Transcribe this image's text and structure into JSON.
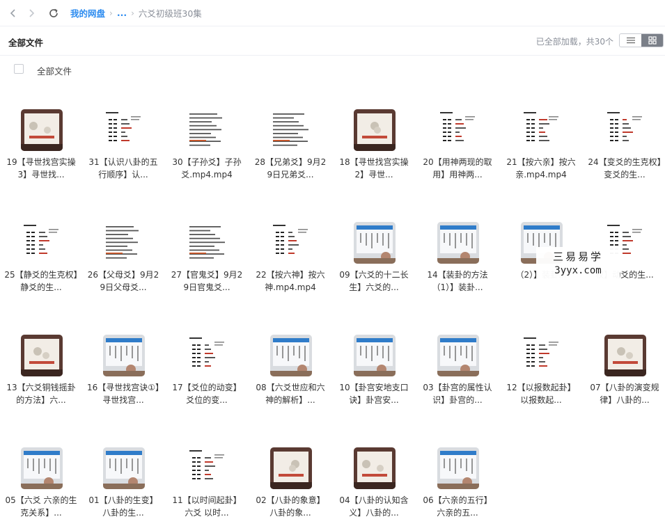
{
  "breadcrumb": {
    "root": "我的网盘",
    "ellipsis": "...",
    "current": "六爻初级班30集"
  },
  "header": {
    "title": "全部文件",
    "status": "已全部加载，共30个",
    "view_modes": [
      "list-view-icon",
      "grid-view-icon"
    ],
    "active_view": "grid"
  },
  "select_all": {
    "label": "全部文件",
    "checked": false
  },
  "files": [
    {
      "name": "19【寻世找宫实操3】寻世找...",
      "thumb": "photo"
    },
    {
      "name": "31【认识八卦的五行顺序】认...",
      "thumb": "chart"
    },
    {
      "name": "30【子孙爻】子孙爻.mp4.mp4",
      "thumb": "text"
    },
    {
      "name": "28【兄弟爻】9月29日兄弟爻...",
      "thumb": "text"
    },
    {
      "name": "18【寻世找宫实操2】寻世...",
      "thumb": "photo"
    },
    {
      "name": "20【用神两现的取用】用神两...",
      "thumb": "chart"
    },
    {
      "name": "21【按六亲】按六亲.mp4.mp4",
      "thumb": "chart"
    },
    {
      "name": "24【变爻的生克权】变爻的生...",
      "thumb": "chart"
    },
    {
      "name": "25【静爻的生克权】静爻的生...",
      "thumb": "chart"
    },
    {
      "name": "26【父母爻】9月29日父母爻...",
      "thumb": "text"
    },
    {
      "name": "27【官鬼爻】9月29日官鬼爻...",
      "thumb": "text"
    },
    {
      "name": "22【按六神】按六神.mp4.mp4",
      "thumb": "chart"
    },
    {
      "name": "09【六爻的十二长生】六爻的...",
      "thumb": "board"
    },
    {
      "name": "14【装卦的方法（1）】装卦...",
      "thumb": "board"
    },
    {
      "name": "（2）】装卦...",
      "thumb": "board"
    },
    {
      "name": "权】动爻的生...",
      "thumb": "chart"
    },
    {
      "name": "13【六爻铜钱摇卦的方法】六...",
      "thumb": "photo"
    },
    {
      "name": "16【寻世找宫诀①】寻世找宫...",
      "thumb": "board"
    },
    {
      "name": "17【爻位的动变】爻位的变...",
      "thumb": "chart"
    },
    {
      "name": "08【六爻世应和六神的解析】...",
      "thumb": "board"
    },
    {
      "name": "10【卦宫安地支口诀】卦宫安...",
      "thumb": "board"
    },
    {
      "name": "03【卦宫的属性认识】卦宫的...",
      "thumb": "board"
    },
    {
      "name": "12【以报数起卦】以报数起...",
      "thumb": "chart"
    },
    {
      "name": "07【八卦的演变规律】八卦的...",
      "thumb": "photo"
    },
    {
      "name": "05【六爻 六亲的生克关系】...",
      "thumb": "board"
    },
    {
      "name": "01【八卦的生变】八卦的生...",
      "thumb": "board"
    },
    {
      "name": "11【以时间起卦】六爻 以时...",
      "thumb": "chart"
    },
    {
      "name": "02【八卦的象意】八卦的象...",
      "thumb": "photo"
    },
    {
      "name": "04【八卦的认知含义】八卦的...",
      "thumb": "photo"
    },
    {
      "name": "06【六亲的五行】六亲的五...",
      "thumb": "board"
    }
  ],
  "watermark": {
    "chinese": "三易易学",
    "url": "3yyx.com"
  },
  "colors": {
    "link": "#2d8cf0",
    "muted": "#8a8f99",
    "border": "#eef0f4",
    "active_toggle": "#7a7f88"
  }
}
